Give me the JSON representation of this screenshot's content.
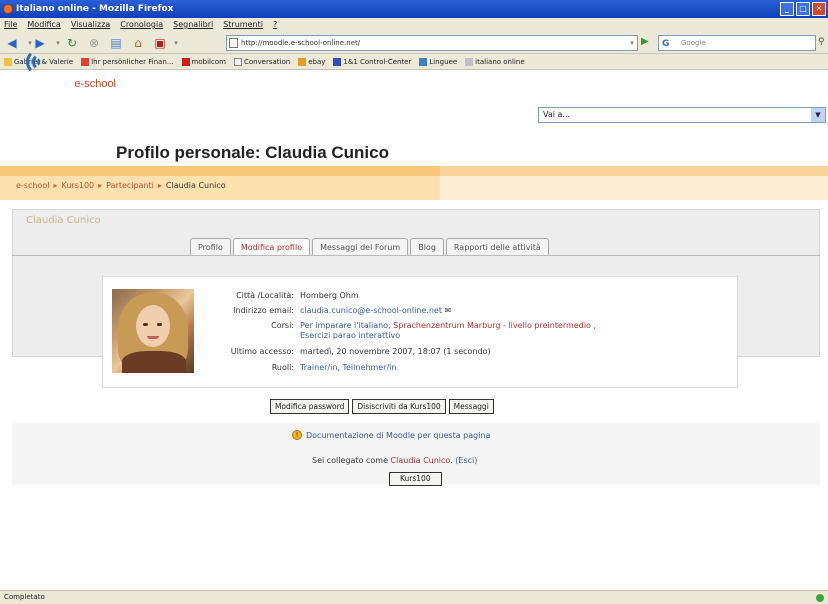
{
  "window": {
    "title": "Italiano online - Mozilla Firefox"
  },
  "menu": [
    "File",
    "Modifica",
    "Visualizza",
    "Cronologia",
    "Segnalibri",
    "Strumenti",
    "?"
  ],
  "nav": {
    "url": "http://moodle.e-school-online.net/",
    "search_placeholder": "Google"
  },
  "bookmarks": [
    {
      "label": "Gabriel & Valerie",
      "color": "#f0c040"
    },
    {
      "label": "Ihr persönlicher Finan...",
      "color": "#e04030"
    },
    {
      "label": "mobilcom",
      "color": "#d02020"
    },
    {
      "label": "Conversation",
      "color": "#f0f0f0"
    },
    {
      "label": "ebay",
      "color": "#e0a020"
    },
    {
      "label": "1&1 Control-Center",
      "color": "#3050c0"
    },
    {
      "label": "Linguee",
      "color": "#4080c0"
    },
    {
      "label": "italiano online",
      "color": "#c0c0c0"
    }
  ],
  "page": {
    "logo_text": "e-school",
    "title": "Profilo personale: Claudia Cunico",
    "jump_to": "Vai a..."
  },
  "breadcrumb": [
    "e-school",
    "Kurs100",
    "Partecipanti",
    "Claudia Cunico"
  ],
  "user_name": "Claudia Cunico",
  "tabs": [
    {
      "label": "Profilo",
      "active": false
    },
    {
      "label": "Modifica profilo",
      "active": true
    },
    {
      "label": "Messaggi del Forum",
      "active": false
    },
    {
      "label": "Blog",
      "active": false
    },
    {
      "label": "Rapporti delle attività",
      "active": false
    }
  ],
  "profile": {
    "city_label": "Città /Località:",
    "city": "Homberg Ohm",
    "email_label": "Indirizzo email:",
    "email": "claudia.cunico@e-school-online.net",
    "courses_label": "Corsi:",
    "courses_prefix": "Per imparare l'italiano,",
    "courses_red": "Sprachenzentrum Marburg - livello preintermedio ,",
    "courses_line2": "Esercizi parao interattivo",
    "last_access_label": "Ultimo accesso:",
    "last_access": "martedì, 20 novembre 2007, 18:07  (1 secondo)",
    "roles_label": "Ruoli:",
    "roles": "Trainer/in, Teilnehmer/in"
  },
  "buttons": {
    "change_password": "Modifica password",
    "unenrol": "Disiscriviti da Kurs100",
    "message": "Messaggi"
  },
  "footer": {
    "doc_link": "Documentazione di Moodle per questa pagina",
    "logged_prefix": "Sei collegato come",
    "logged_user": "Claudia Cunico",
    "logged_exit": "(Esci)",
    "course_button": "Kurs100"
  },
  "status": "Completato"
}
